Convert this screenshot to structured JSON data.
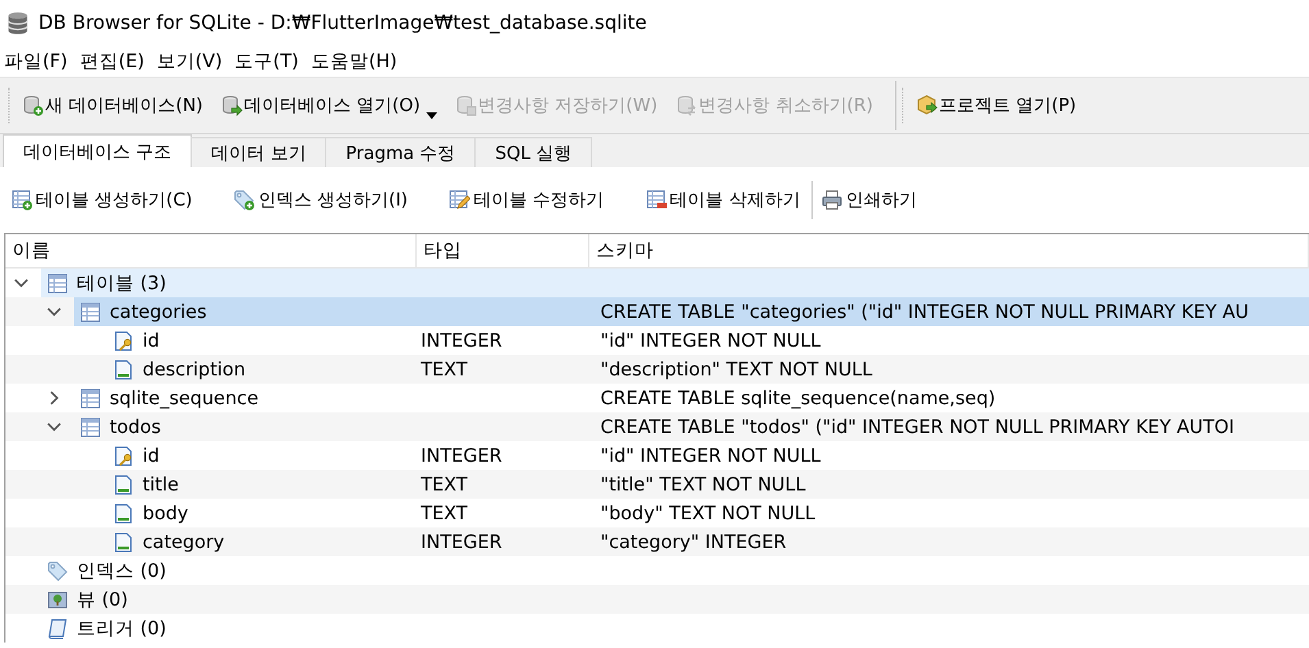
{
  "window": {
    "title": "DB Browser for SQLite - D:₩FlutterImage₩test_database.sqlite"
  },
  "menu": [
    "파일(F)",
    "편집(E)",
    "보기(V)",
    "도구(T)",
    "도움말(H)"
  ],
  "toolbar": [
    {
      "label": "새 데이터베이스(N)",
      "disabled": false
    },
    {
      "label": "데이터베이스 열기(O)",
      "disabled": false,
      "dropdown": true
    },
    {
      "label": "변경사항 저장하기(W)",
      "disabled": true
    },
    {
      "label": "변경사항 취소하기(R)",
      "disabled": true
    },
    {
      "label": "프로젝트 열기(P)",
      "disabled": false,
      "separator": true
    }
  ],
  "tabs": [
    {
      "label": "데이터베이스 구조",
      "selected": true
    },
    {
      "label": "데이터 보기",
      "selected": false
    },
    {
      "label": "Pragma 수정",
      "selected": false
    },
    {
      "label": "SQL 실행",
      "selected": false
    }
  ],
  "actions": [
    {
      "label": "테이블 생성하기(C)"
    },
    {
      "label": "인덱스 생성하기(I)"
    },
    {
      "label": "테이블 수정하기"
    },
    {
      "label": "테이블 삭제하기"
    },
    {
      "label": "인쇄하기",
      "separator": true
    }
  ],
  "tree": {
    "columns": [
      "이름",
      "타입",
      "스키마"
    ],
    "items": [
      {
        "name": "테이블 (3)",
        "kind": "group",
        "expanded": true,
        "selected": false,
        "hovered": true,
        "children": [
          {
            "name": "categories",
            "kind": "table",
            "expanded": true,
            "selected": true,
            "hovered": false,
            "schema": "CREATE TABLE \"categories\" (\"id\" INTEGER NOT NULL PRIMARY KEY AU",
            "children": [
              {
                "name": "id",
                "kind": "key",
                "type": "INTEGER",
                "schema": "\"id\" INTEGER NOT NULL",
                "selected": false,
                "hovered": false
              },
              {
                "name": "description",
                "kind": "field",
                "type": "TEXT",
                "schema": "\"description\" TEXT NOT NULL",
                "selected": false,
                "hovered": false
              }
            ]
          },
          {
            "name": "sqlite_sequence",
            "kind": "table",
            "expanded": false,
            "selected": false,
            "hovered": false,
            "schema": "CREATE TABLE sqlite_sequence(name,seq)"
          },
          {
            "name": "todos",
            "kind": "table",
            "expanded": true,
            "selected": false,
            "hovered": false,
            "schema": "CREATE TABLE \"todos\" (\"id\" INTEGER NOT NULL PRIMARY KEY AUTOI",
            "children": [
              {
                "name": "id",
                "kind": "key",
                "type": "INTEGER",
                "schema": "\"id\" INTEGER NOT NULL",
                "selected": false,
                "hovered": false
              },
              {
                "name": "title",
                "kind": "field",
                "type": "TEXT",
                "schema": "\"title\" TEXT NOT NULL",
                "selected": false,
                "hovered": false
              },
              {
                "name": "body",
                "kind": "field",
                "type": "TEXT",
                "schema": "\"body\" TEXT NOT NULL",
                "selected": false,
                "hovered": false
              },
              {
                "name": "category",
                "kind": "field",
                "type": "INTEGER",
                "schema": "\"category\" INTEGER",
                "selected": false,
                "hovered": false
              }
            ]
          }
        ]
      },
      {
        "name": "인덱스 (0)",
        "kind": "index",
        "selected": false,
        "hovered": false
      },
      {
        "name": "뷰 (0)",
        "kind": "view",
        "selected": false,
        "hovered": false
      },
      {
        "name": "트리거 (0)",
        "kind": "trigger",
        "selected": false,
        "hovered": false
      }
    ]
  }
}
